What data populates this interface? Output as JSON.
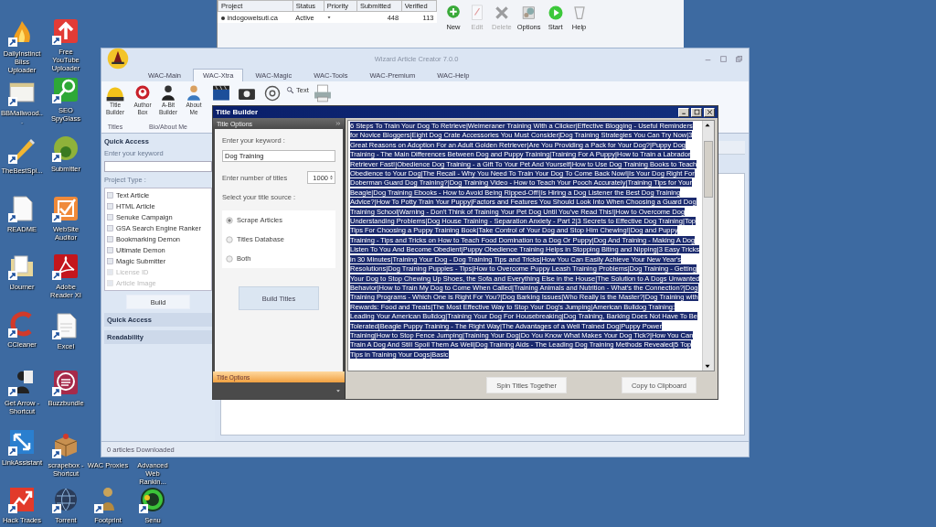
{
  "desktop_icons": [
    {
      "label": "DailyInstinct Bliss Uploader"
    },
    {
      "label": "BBMailwood..."
    },
    {
      "label": "TheBestSpi..."
    },
    {
      "label": "README"
    },
    {
      "label": "iJourner"
    },
    {
      "label": "CCleaner"
    },
    {
      "label": "Get Arrow - Shortcut"
    },
    {
      "label": "LinkAssistant"
    },
    {
      "label": "Hack Trades"
    },
    {
      "label": "Free YouTube Uploader"
    },
    {
      "label": "SEO SpyGlass"
    },
    {
      "label": "Submitter"
    },
    {
      "label": "WebSite Auditor"
    },
    {
      "label": "Adobe Reader XI"
    },
    {
      "label": "Excel"
    },
    {
      "label": "Buzzbundle"
    },
    {
      "label": "scrapebox - Shortcut"
    },
    {
      "label": "Torrent"
    },
    {
      "label": "Footprint"
    },
    {
      "label": "Senu"
    }
  ],
  "covered_icon_labels": [
    "WAC Proxies",
    "Advanced Web Rankin..."
  ],
  "project_window": {
    "columns": [
      "Project",
      "Status",
      "Priority",
      "Submitted",
      "Verified"
    ],
    "rows": [
      {
        "project": "indogowelsuti.ca",
        "status": "Active",
        "submitted": "448",
        "verified": "113"
      }
    ],
    "toolbar": [
      {
        "label": "New",
        "disabled": false
      },
      {
        "label": "Edit",
        "disabled": true
      },
      {
        "label": "Delete",
        "disabled": true
      },
      {
        "label": "Options",
        "disabled": false
      },
      {
        "label": "Start",
        "disabled": false
      },
      {
        "label": "Help",
        "disabled": false
      }
    ]
  },
  "wac_window": {
    "title": "Wizard Article Creator 7.0.0",
    "tabs": [
      {
        "label": "WAC-Main",
        "selected": false
      },
      {
        "label": "WAC-Xtra",
        "selected": true
      },
      {
        "label": "WAC-Magic",
        "selected": false
      },
      {
        "label": "WAC-Tools",
        "selected": false
      },
      {
        "label": "WAC-Premium",
        "selected": false
      },
      {
        "label": "WAC-Help",
        "selected": false
      }
    ],
    "ribbon_groups": [
      {
        "label": "Titles",
        "buttons": [
          "Title Builder"
        ]
      },
      {
        "label": "Bio/About Me",
        "buttons": [
          "Author Box",
          "A-Bit Builder",
          "About Me"
        ]
      },
      {
        "buttons": [
          "Text"
        ]
      }
    ],
    "sidebar": {
      "header": "Quick Access",
      "keyword_label": "Enter your keyword",
      "project_type_label": "Project Type :",
      "project_types": [
        {
          "label": "Text Article",
          "disabled": false
        },
        {
          "label": "HTML Article",
          "disabled": false
        },
        {
          "label": "Senuke Campaign",
          "disabled": false
        },
        {
          "label": "GSA Search Engine Ranker",
          "disabled": false
        },
        {
          "label": "Bookmarking Demon",
          "disabled": false
        },
        {
          "label": "Ultimate Demon",
          "disabled": false
        },
        {
          "label": "Magic Submitter",
          "disabled": false
        },
        {
          "label": "License ID",
          "disabled": true
        },
        {
          "label": "Article Image",
          "disabled": true
        }
      ],
      "build_button": "Build",
      "sections": [
        "Quick Access",
        "Readability"
      ]
    },
    "status_bar": "0 articles Downloaded"
  },
  "title_builder": {
    "title": "Title Builder",
    "panel_header": "Title Options",
    "keyword_label": "Enter your keyword :",
    "keyword": "Dog Training",
    "count_label": "Enter number of titles",
    "count": "1000",
    "source_label": "Select your title source :",
    "sources": [
      {
        "label": "Scrape Articles",
        "selected": true
      },
      {
        "label": "Titles Database",
        "selected": false
      },
      {
        "label": "Both",
        "selected": false
      }
    ],
    "build_button": "Build Titles",
    "footer_tab": "Title Options",
    "titles_text": "6 Steps To Train Your Dog To Retrieve|Weimeraner Training With a Clicker|Effective Blogging - Useful Reminders for Novice Bloggers|Eight Dog Crate Accessories You Must Consider|Dog Training Strategies You Can Try Now|3 Great Reasons on Adoption For an Adult Golden Retriever|Are You Providing a Pack for Your Dog?|Puppy Dog Training - The Main Differences Between Dog and Puppy Training|Training For A Puppy|How to Train a Labrador Retriever Fast!|Obedience Dog Training - a Gift To Your Pet And Yourself|How to Use Dog Training Books to Teach Obedience to Your Dog|The Recall - Why You Need To Train Your Dog To Come Back Now!|Is Your Dog Right For Doberman Guard Dog Training?|Dog Training Video - How to Teach Your Pooch Accurately|Training Tips for Your Beagle|Dog Training Ebooks - How to Avoid Being Ripped-Off!|Is Hiring a Dog Listener the Best Dog Training Advice?|How To Potty Train Your Puppy|Factors and Features You Should Look Into When Choosing a Guard Dog Training School|Warning - Don't Think of Training Your Pet Dog Until You've Read This!|How to Overcome Dog Understanding Problems|Dog House Training - Separation Anxiety - Part 2|3 Secrets to Effective Dog Training|Top Tips For Choosing a Puppy Training Book|Take Control of Your Dog and Stop Him Chewing!|Dog and Puppy Training - Tips and Tricks on How to Teach Food Domination to a Dog Or Puppy|Dog And Training - Making A Dog Listen To You And Become Obedient|Puppy Obedience Training Helps in Stopping Biting and Nipping|3 Easy Tricks in 30 Minutes|Training Your Dog - Dog Training Tips and Tricks|How You Can Easily Achieve Your New Year's Resolutions|Dog Training Puppies - Tips|How to Overcome Puppy Leash Training Problems|Dog Training - Getting Your Dog to Stop Chewing Up Shoes, the Sofa and Everything Else in the House|The Solution to A Dogs Unwanted Behavior|How to Train My Dog to Come When Called|Training Animals and Nutrition - What's the Connection?|Dog Training Programs - Which One is Right For You?|Dog Barking Issues|Who Really is the Master?|Dog Training with Rewards: Food and Treats|The Most Effective Way to Stop Your Dog's Jumping|American Bulldog Training: Leading Your American Bulldog|Training Your Dog For Housebreaking|Dog Training, Barking Does Not Have To Be Tolerated|Beagle Puppy Training - The Right Way|The Advantages of a Well Trained Dog|Puppy Power Training|How to Stop Fence Jumping|Training Your Dog|Do You Know What Makes Your Dog Tick?|How You Can Train A Dog And Still Spoil Them As Well|Dog Training Aids - The Leading Dog Training Methods Revealed|5 Top Tips in Training Your Dogs|Basic",
    "buttons": [
      "Spin Titles Together",
      "Copy to Clipboard"
    ]
  }
}
